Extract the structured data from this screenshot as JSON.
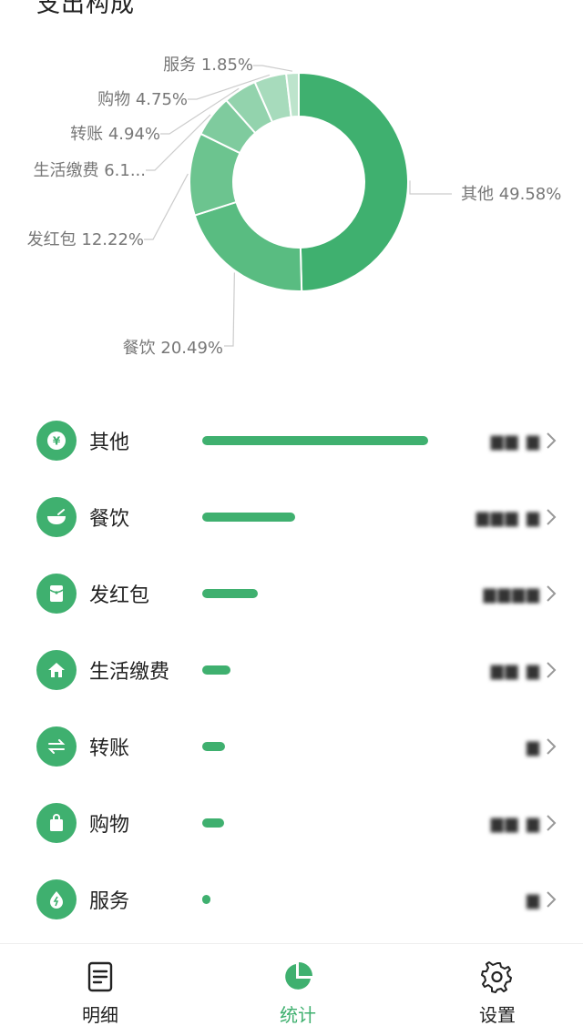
{
  "header": {
    "title": "支出构成"
  },
  "chart_data": {
    "type": "pie",
    "style": "donut",
    "categories": [
      "其他",
      "餐饮",
      "发红包",
      "生活缴费",
      "转账",
      "购物",
      "服务"
    ],
    "values": [
      49.58,
      20.49,
      12.22,
      6.17,
      4.94,
      4.75,
      1.85
    ],
    "labels": [
      "其他 49.58%",
      "餐饮 20.49%",
      "发红包 12.22%",
      "生活缴费 6.1...",
      "转账 4.94%",
      "购物 4.75%",
      "服务 1.85%"
    ],
    "colors": [
      "#3fb06f",
      "#59bc81",
      "#6cc48f",
      "#7fcb9e",
      "#93d3ad",
      "#a7dbbc",
      "#bde4cc"
    ]
  },
  "list": {
    "items": [
      {
        "name": "其他",
        "icon": "yen-icon",
        "percent": 49.58,
        "amount": "▆▆ ▆"
      },
      {
        "name": "餐饮",
        "icon": "bowl-icon",
        "percent": 20.49,
        "amount": "▆▆▆ ▆"
      },
      {
        "name": "发红包",
        "icon": "red-envelope-icon",
        "percent": 12.22,
        "amount": "▆▆▆▆"
      },
      {
        "name": "生活缴费",
        "icon": "home-icon",
        "percent": 6.17,
        "amount": "▆▆ ▆"
      },
      {
        "name": "转账",
        "icon": "transfer-icon",
        "percent": 4.94,
        "amount": "▆"
      },
      {
        "name": "购物",
        "icon": "shopping-bag-icon",
        "percent": 4.75,
        "amount": "▆▆ ▆"
      },
      {
        "name": "服务",
        "icon": "service-icon",
        "percent": 1.85,
        "amount": "▆"
      }
    ]
  },
  "tabbar": {
    "tabs": [
      {
        "label": "明细",
        "icon": "document-icon",
        "active": false
      },
      {
        "label": "统计",
        "icon": "pie-chart-icon",
        "active": true
      },
      {
        "label": "设置",
        "icon": "gear-icon",
        "active": false
      }
    ]
  },
  "colors": {
    "accent": "#3fb06f"
  }
}
